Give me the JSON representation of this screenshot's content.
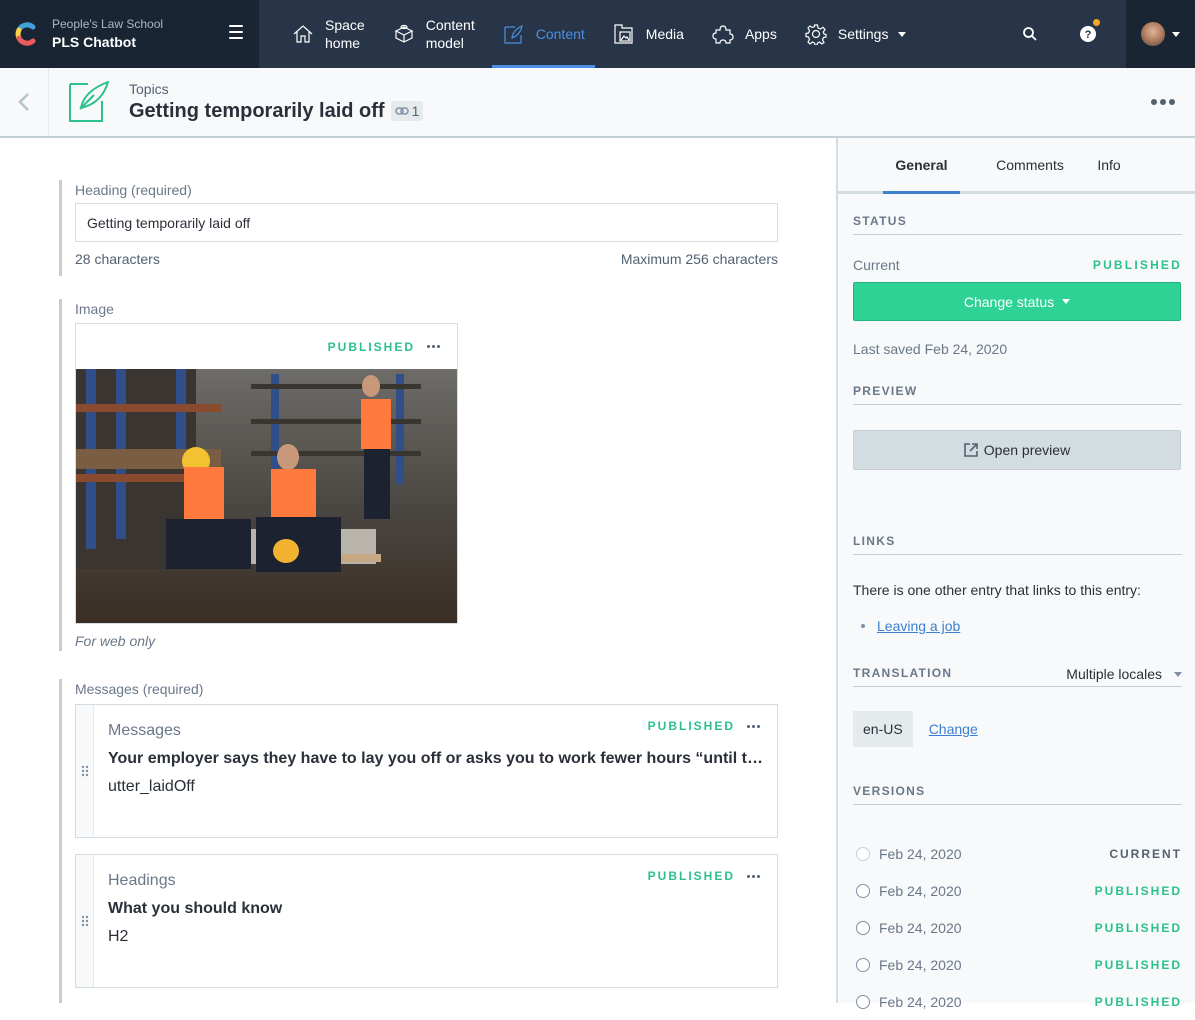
{
  "topbar": {
    "org_name": "People's Law School",
    "space_name": "PLS Chatbot",
    "nav": [
      {
        "label": "Space\nhome",
        "icon": "home-icon",
        "active": false
      },
      {
        "label": "Content\nmodel",
        "icon": "content-model-icon",
        "active": false
      },
      {
        "label": "Content",
        "icon": "content-icon",
        "active": true
      },
      {
        "label": "Media",
        "icon": "media-icon",
        "active": false
      },
      {
        "label": "Apps",
        "icon": "apps-icon",
        "active": false
      },
      {
        "label": "Settings",
        "icon": "settings-icon",
        "active": false,
        "has_dropdown": true
      }
    ],
    "accent_color": "#4a90e2",
    "notification_color": "#f5a623"
  },
  "entry_header": {
    "content_type": "Topics",
    "title": "Getting temporarily laid off",
    "link_count": "1"
  },
  "editor": {
    "heading_field": {
      "label": "Heading (required)",
      "value": "Getting temporarily laid off",
      "char_count": "28 characters",
      "max_hint": "Maximum 256 characters"
    },
    "image_field": {
      "label": "Image",
      "status": "PUBLISHED",
      "help_text": "For web only"
    },
    "messages_field": {
      "label": "Messages (required)",
      "references": [
        {
          "type": "Messages",
          "status": "PUBLISHED",
          "title": "Your employer says they have to lay you off or asks you to work fewer hours “until things pick up”",
          "subtitle": "utter_laidOff"
        },
        {
          "type": "Headings",
          "status": "PUBLISHED",
          "title": "What you should know",
          "subtitle": "H2"
        }
      ]
    }
  },
  "sidebar": {
    "tabs": [
      {
        "label": "General",
        "active": true
      },
      {
        "label": "Comments",
        "active": false
      },
      {
        "label": "Info",
        "active": false
      }
    ],
    "status": {
      "section_title": "STATUS",
      "current_label": "Current",
      "current_value": "PUBLISHED",
      "change_button": "Change status",
      "last_saved": "Last saved Feb 24, 2020"
    },
    "preview": {
      "section_title": "PREVIEW",
      "button": "Open preview"
    },
    "links": {
      "section_title": "LINKS",
      "text": "There is one other entry that links to this entry:",
      "items": [
        "Leaving a job"
      ]
    },
    "translation": {
      "section_title": "TRANSLATION",
      "locale_mode": "Multiple locales",
      "locale": "en-US",
      "change_link": "Change"
    },
    "versions": {
      "section_title": "VERSIONS",
      "items": [
        {
          "date": "Feb 24, 2020",
          "status": "CURRENT"
        },
        {
          "date": "Feb 24, 2020",
          "status": "PUBLISHED"
        },
        {
          "date": "Feb 24, 2020",
          "status": "PUBLISHED"
        },
        {
          "date": "Feb 24, 2020",
          "status": "PUBLISHED"
        },
        {
          "date": "Feb 24, 2020",
          "status": "PUBLISHED"
        }
      ]
    },
    "published_color": "#2cc08d",
    "button_green": "#2ed295"
  }
}
